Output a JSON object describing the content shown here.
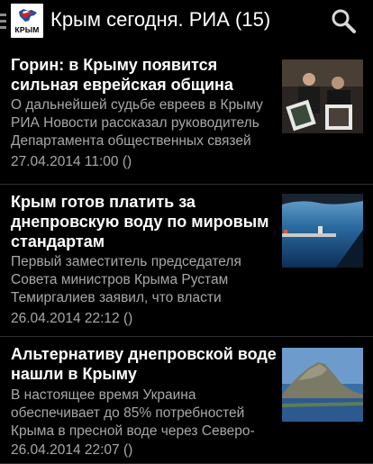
{
  "app": {
    "logo_text": "КРЫМ",
    "title": "Крым сегодня.  РИА (15)"
  },
  "articles": [
    {
      "headline": "Горин: в Крыму появится сильная еврейская община",
      "summary": "О дальнейшей судьбе евреев в Крыму РИА Новости рассказал руководитель Департамента общественных связей",
      "date": "27.04.2014 11:00 ()",
      "thumbnail": "photo-two-men-holding-framed-pictures"
    },
    {
      "headline": "Крым готов платить за днепровскую воду по мировым стандартам",
      "summary": "Первый заместитель председателя Совета министров Крыма Рустам Темиргалиев заявил, что власти",
      "date": "26.04.2014 22:12 ()",
      "thumbnail": "photo-pier-and-blue-sea"
    },
    {
      "headline": "Альтернативу днепровской воде нашли в Крыму",
      "summary": "В настоящее время Украина обеспечивает до 85% потребностей Крыма в пресной воде через Северо-",
      "date": "26.04.2014 22:07 ()",
      "thumbnail": "photo-mountain-and-lake"
    }
  ],
  "colors": {
    "background": "#000000",
    "headline": "#ffffff",
    "secondary_text": "#a8a8a8"
  }
}
